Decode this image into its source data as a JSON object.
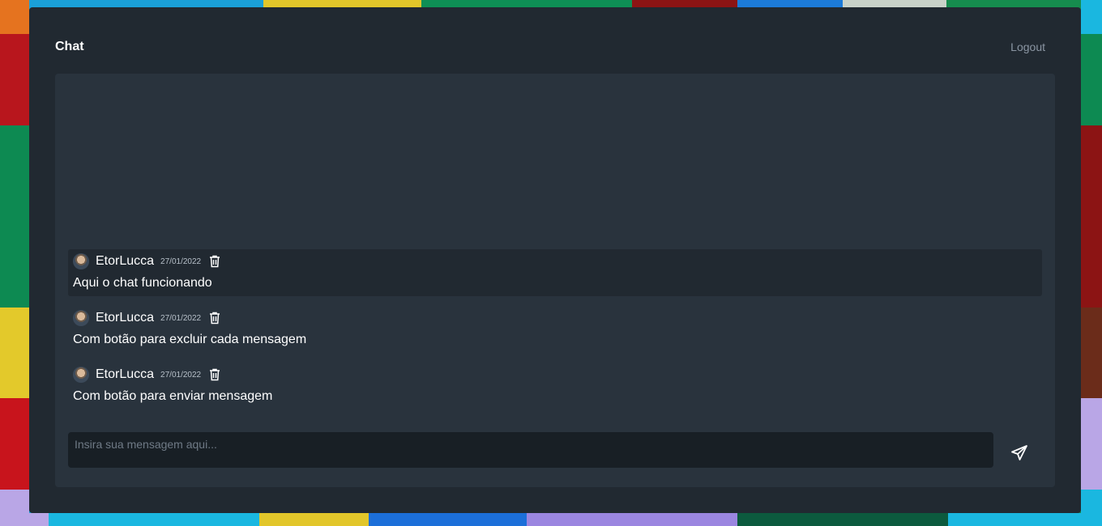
{
  "header": {
    "title": "Chat",
    "logout_label": "Logout"
  },
  "messages": [
    {
      "user": "EtorLucca",
      "date": "27/01/2022",
      "text": "Aqui o chat funcionando",
      "avatar_icon": "avatar-icon",
      "delete_icon": "trash-icon"
    },
    {
      "user": "EtorLucca",
      "date": "27/01/2022",
      "text": "Com botão para excluir cada mensagem",
      "avatar_icon": "avatar-icon",
      "delete_icon": "trash-icon"
    },
    {
      "user": "EtorLucca",
      "date": "27/01/2022",
      "text": "Com botão para enviar mensagem",
      "avatar_icon": "avatar-icon",
      "delete_icon": "trash-icon"
    }
  ],
  "composer": {
    "placeholder": "Insira sua mensagem aqui...",
    "value": "",
    "send_icon": "paper-plane-icon"
  },
  "colors": {
    "window": "#212931",
    "panel": "#29333d",
    "input": "#181f25",
    "highlight": "#212931",
    "text": "#ffffff"
  }
}
